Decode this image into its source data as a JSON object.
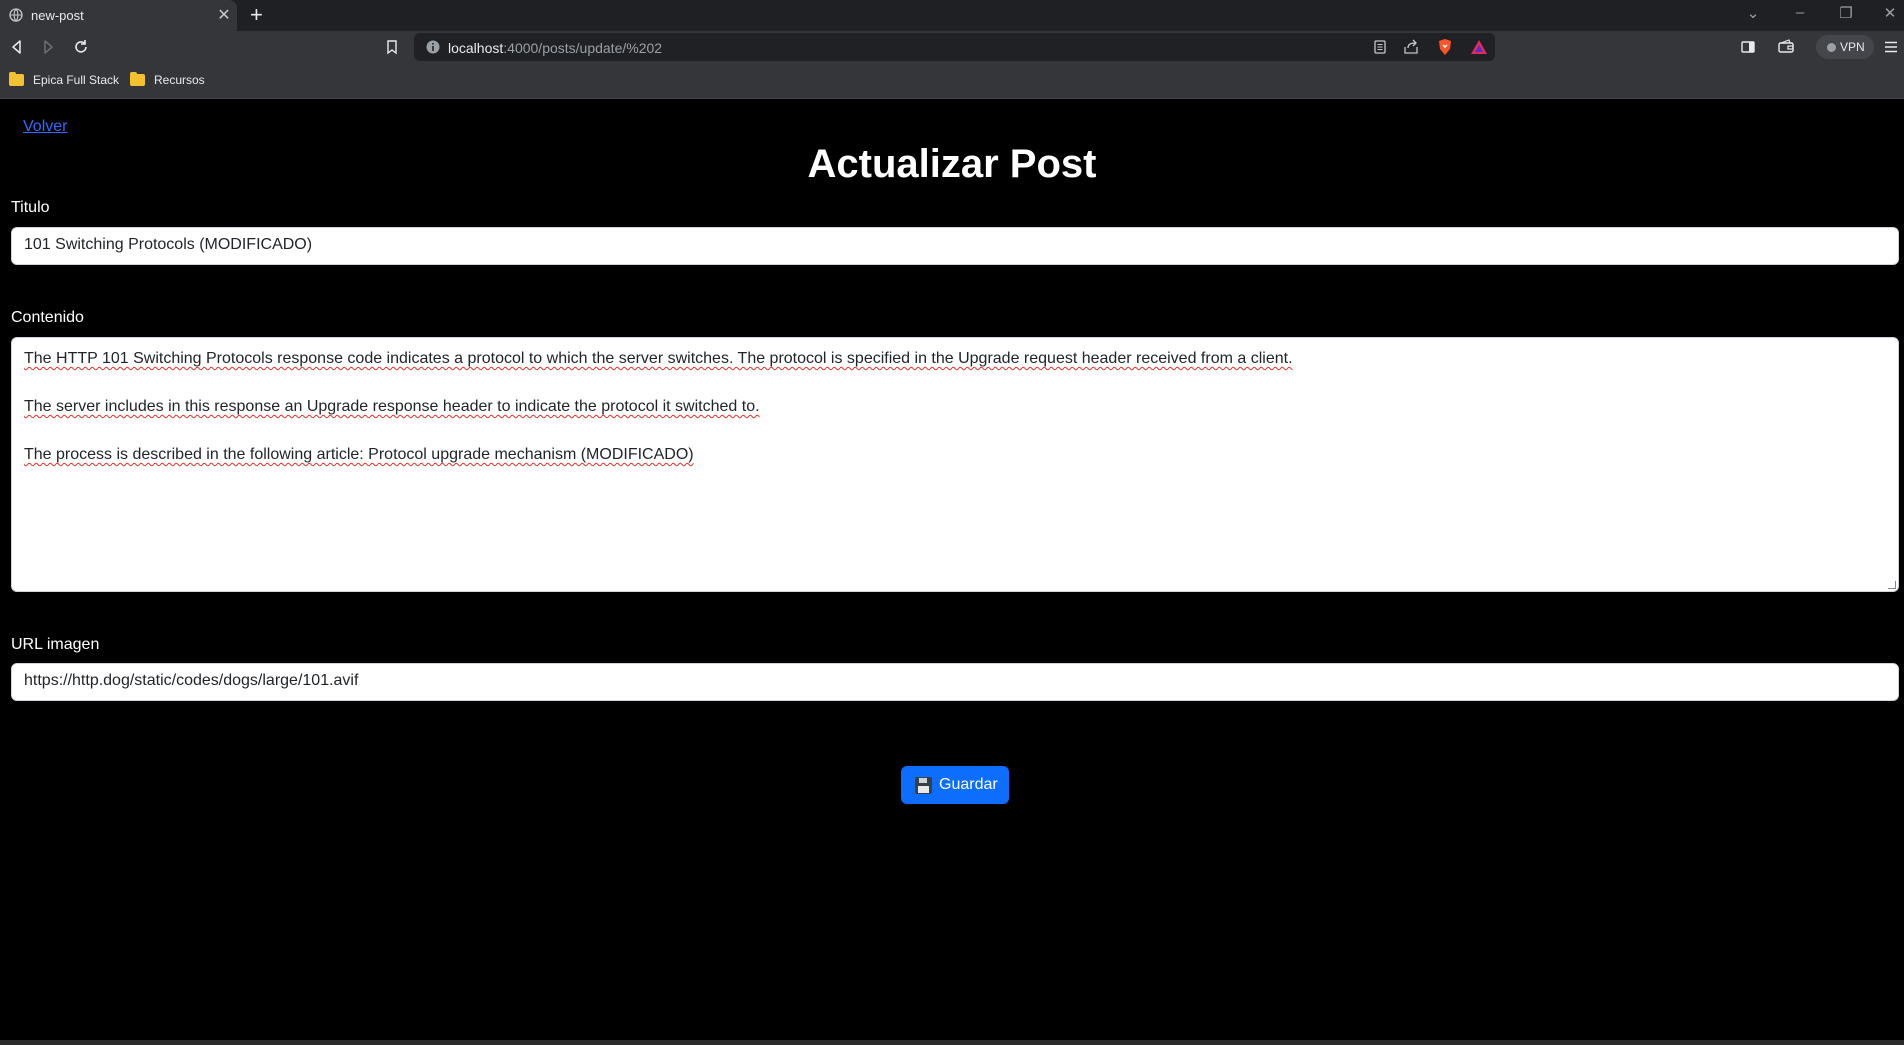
{
  "browser": {
    "tab_title": "new-post",
    "new_tab_symbol": "+",
    "url_host": "localhost",
    "url_rest": ":4000/posts/update/%202",
    "vpn_label": "VPN",
    "bookmarks": [
      {
        "label": "Epica Full Stack"
      },
      {
        "label": "Recursos"
      }
    ]
  },
  "page": {
    "back_link": "Volver",
    "title": "Actualizar Post",
    "fields": {
      "titulo_label": "Titulo",
      "titulo_value": "101 Switching Protocols (MODIFICADO)",
      "contenido_label": "Contenido",
      "contenido_paragraphs": [
        "The HTTP 101 Switching Protocols response code indicates a protocol to which the server switches. The protocol is specified in the Upgrade request header received from a client.",
        "The server includes in this response an Upgrade response header to indicate the protocol it switched to.",
        "The process is described in the following article: Protocol upgrade mechanism (MODIFICADO)"
      ],
      "url_label": "URL imagen",
      "url_value": "https://http.dog/static/codes/dogs/large/101.avif"
    },
    "save_button": "Guardar"
  },
  "colors": {
    "page_bg": "#000000",
    "primary": "#0d6efd",
    "link": "#2f6bff",
    "chrome_bg": "#35363a"
  }
}
